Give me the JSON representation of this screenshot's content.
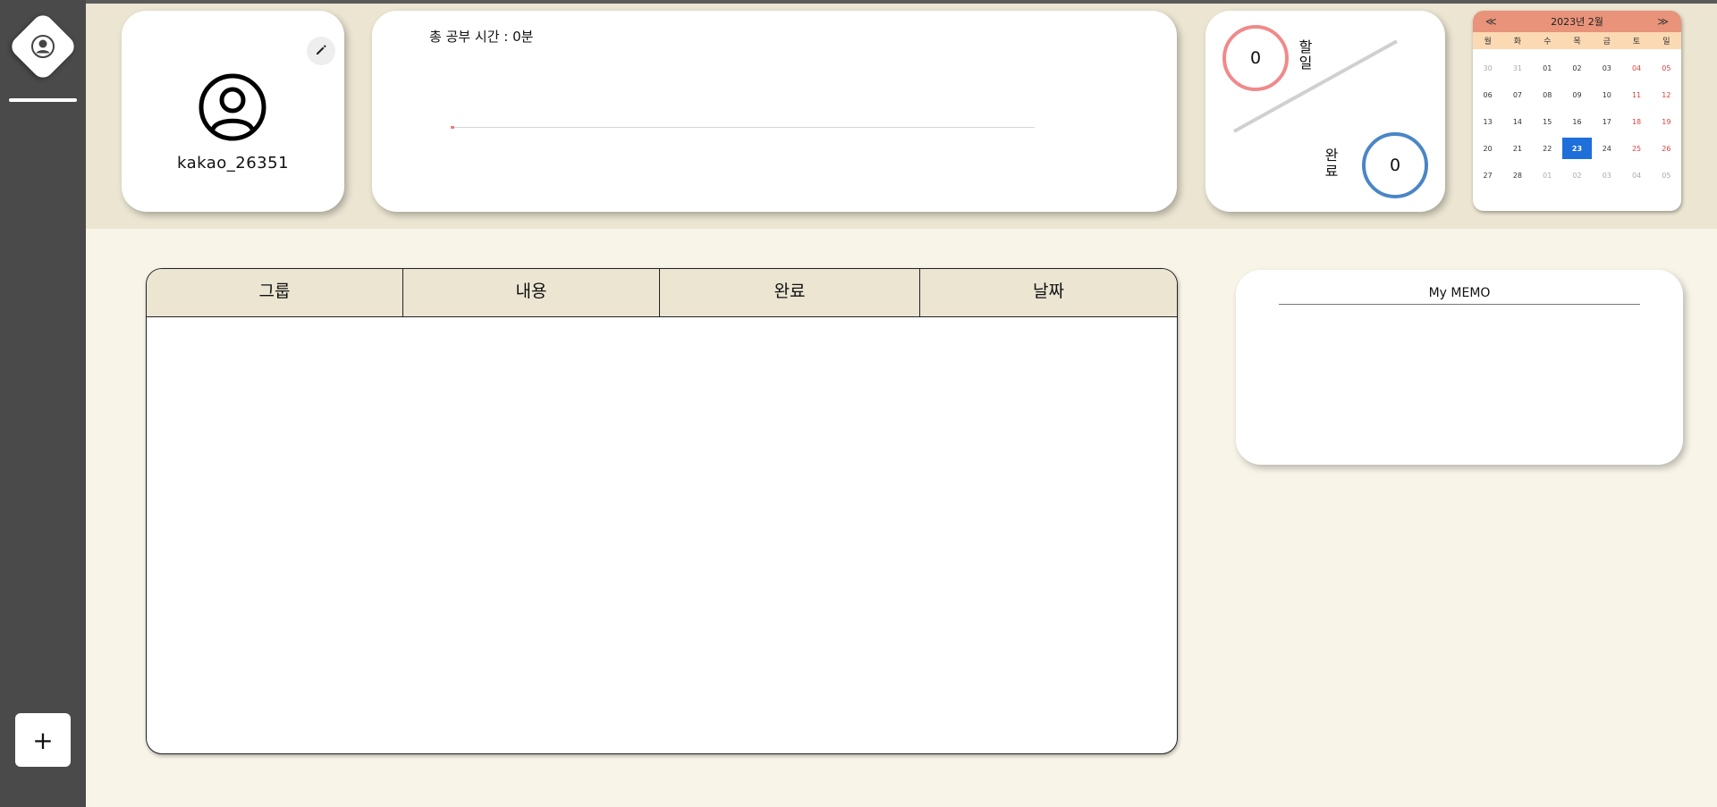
{
  "sidebar": {
    "logo_icon": "user-circle-icon",
    "add_label": "+"
  },
  "profile": {
    "username": "kakao_26351",
    "edit_icon": "pencil-icon",
    "avatar_icon": "user-circle-icon"
  },
  "study": {
    "label": "총 공부 시간 : 0분"
  },
  "todo_stats": {
    "todo_count": "0",
    "todo_label_1": "할",
    "todo_label_2": "일",
    "done_count": "0",
    "done_label_1": "완",
    "done_label_2": "료"
  },
  "calendar": {
    "prev": "≪",
    "next": "≫",
    "title": "2023년 2월",
    "weekdays": [
      "월",
      "화",
      "수",
      "목",
      "금",
      "토",
      "일"
    ],
    "days": [
      {
        "d": "30",
        "muted": true
      },
      {
        "d": "31",
        "muted": true
      },
      {
        "d": "01"
      },
      {
        "d": "02"
      },
      {
        "d": "03"
      },
      {
        "d": "04",
        "weekend": true
      },
      {
        "d": "05",
        "weekend": true
      },
      {
        "d": "06"
      },
      {
        "d": "07"
      },
      {
        "d": "08"
      },
      {
        "d": "09"
      },
      {
        "d": "10"
      },
      {
        "d": "11",
        "weekend": true
      },
      {
        "d": "12",
        "weekend": true
      },
      {
        "d": "13"
      },
      {
        "d": "14"
      },
      {
        "d": "15"
      },
      {
        "d": "16"
      },
      {
        "d": "17"
      },
      {
        "d": "18",
        "weekend": true
      },
      {
        "d": "19",
        "weekend": true
      },
      {
        "d": "20"
      },
      {
        "d": "21"
      },
      {
        "d": "22"
      },
      {
        "d": "23",
        "today": true
      },
      {
        "d": "24"
      },
      {
        "d": "25",
        "weekend": true
      },
      {
        "d": "26",
        "weekend": true
      },
      {
        "d": "27"
      },
      {
        "d": "28"
      },
      {
        "d": "01",
        "muted": true
      },
      {
        "d": "02",
        "muted": true
      },
      {
        "d": "03",
        "muted": true
      },
      {
        "d": "04",
        "muted": true,
        "weekend": true
      },
      {
        "d": "05",
        "muted": true,
        "weekend": true
      }
    ],
    "today_color": "#1e6fd9",
    "header_color": "#e8937a",
    "weekday_bg": "#fbd9b3"
  },
  "table": {
    "headers": [
      "그룹",
      "내용",
      "완료",
      "날짜"
    ],
    "rows": []
  },
  "memo": {
    "title": "My MEMO"
  },
  "colors": {
    "sidebar": "#4a4a4a",
    "top_band": "#ebe5d2",
    "background": "#f8f4e8",
    "todo_circle": "#f08a8a",
    "done_circle": "#4a86c6"
  }
}
